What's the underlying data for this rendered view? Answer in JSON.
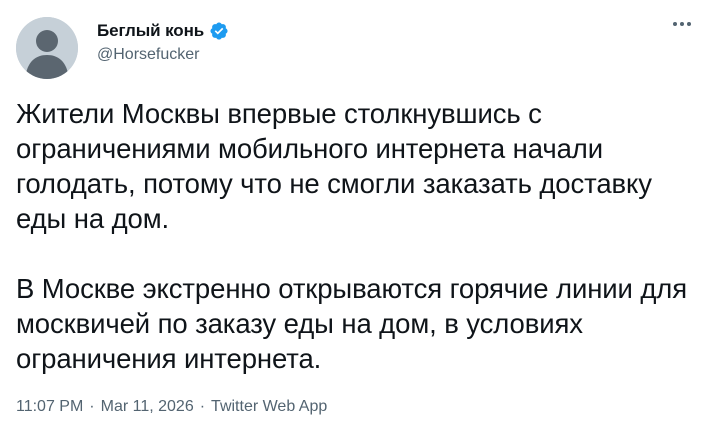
{
  "author": {
    "display_name": "Беглый конь",
    "handle": "@Horsefucker",
    "verified_color": "#1d9bf0",
    "avatar_icon": "default-avatar-silhouette"
  },
  "more_icon": "ellipsis-icon",
  "tweet": {
    "paragraphs": [
      "Жители Москвы впервые столкнувшись с ограничениями мобильного интернета начали голодать, потому что не смогли заказать доставку еды на дом.",
      "В Москве экстренно открываются горячие линии для москвичей по заказу еды на дом, в условиях ограничения интернета."
    ]
  },
  "meta": {
    "time": "11:07 PM",
    "date": "Mar 11, 2026",
    "source": "Twitter Web App",
    "separator": "·"
  },
  "colors": {
    "text": "#0f1419",
    "secondary": "#536471",
    "accent": "#1d9bf0"
  }
}
